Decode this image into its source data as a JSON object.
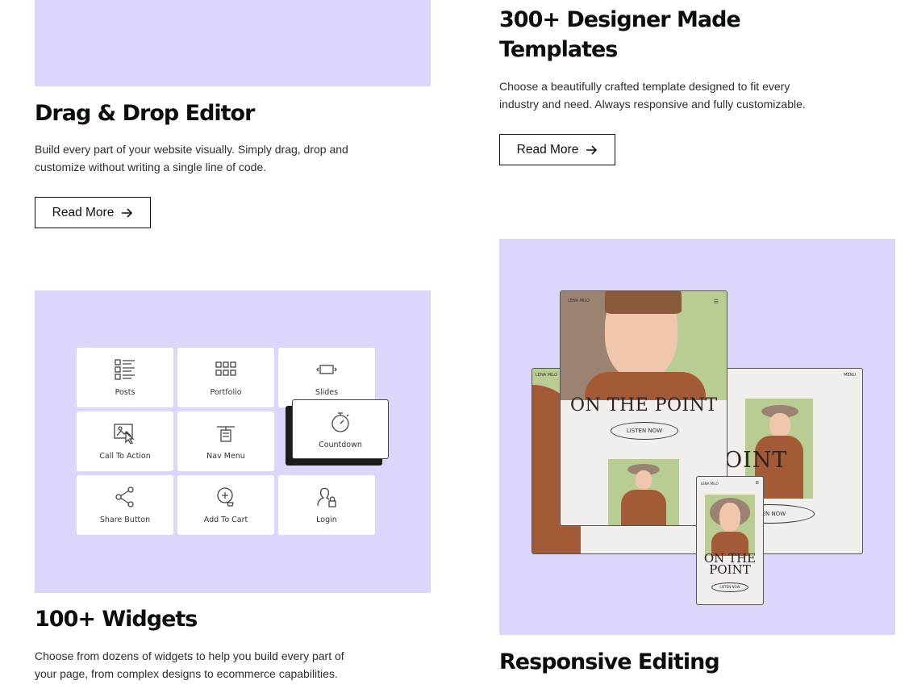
{
  "features": {
    "drag_drop": {
      "title": "Drag & Drop Editor",
      "description_line1": "Build every part of your website visually. Simply drag, drop and",
      "description_line2": "customize without writing a single line of code.",
      "button_label": "Read More"
    },
    "templates": {
      "title_line1": "300+ Designer Made",
      "title_line2": "Templates",
      "description_line1": "Choose a beautifully crafted template designed to fit every",
      "description_line2": "industry and need. Always responsive and fully customizable.",
      "button_label": "Read More"
    },
    "widgets": {
      "title": "100+ Widgets",
      "description_line1": "Choose from dozens of widgets to help you build every part of",
      "description_line2": "your page, from complex designs to ecommerce capabilities."
    },
    "responsive": {
      "title": "Responsive Editing"
    }
  },
  "widget_grid": {
    "tiles": [
      {
        "label": "Posts",
        "icon": "posts-icon"
      },
      {
        "label": "Portfolio",
        "icon": "portfolio-icon"
      },
      {
        "label": "Slides",
        "icon": "slides-icon"
      },
      {
        "label": "Call To Action",
        "icon": "call-to-action-icon"
      },
      {
        "label": "Nav Menu",
        "icon": "nav-menu-icon"
      },
      {
        "label": "Countdown",
        "icon": "countdown-icon"
      },
      {
        "label": "Share Button",
        "icon": "share-icon"
      },
      {
        "label": "Add To Cart",
        "icon": "add-to-cart-icon"
      },
      {
        "label": "Login",
        "icon": "login-icon"
      }
    ]
  },
  "mockup": {
    "brand": "LENA MILO",
    "menu": "MENU",
    "headline": "ON THE POINT",
    "headline_partial": "OINT",
    "cta": "LISTEN NOW",
    "cta_partial": "ISTEN NOW",
    "mobile_headline_line1": "ON THE",
    "mobile_headline_line2": "POINT"
  },
  "colors": {
    "lavender": "#dcd6fc",
    "text": "#0c0d0e",
    "photo_green": "#b9cc94",
    "sweater_rust": "#a35a36",
    "hat_taupe": "#9c8371"
  }
}
